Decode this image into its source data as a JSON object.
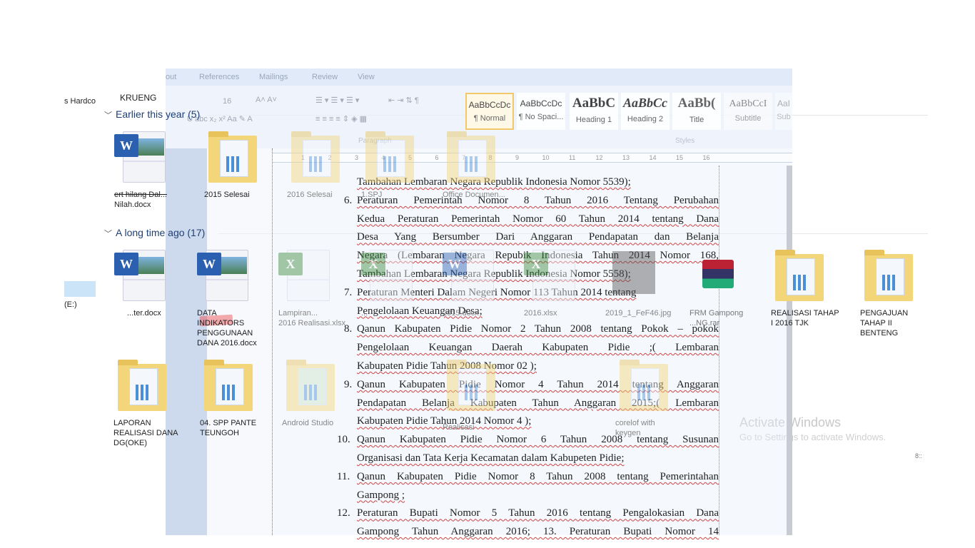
{
  "explorer": {
    "nav": {
      "drive_hardcopy": "s Hardco",
      "drive_e": "(E:)",
      "folder_header": "KRUENG"
    },
    "groups": [
      {
        "label": "Earlier this year (5)",
        "items": [
          {
            "name": "ert hilang Dal...",
            "name2": "Nilah.docx",
            "type": "word"
          },
          {
            "name": "2015 Selesai",
            "type": "folder"
          },
          {
            "name": "2016 Selesai",
            "type": "folder"
          },
          {
            "name": "1.SPJ",
            "type": "folder"
          },
          {
            "name": "Office Documen...",
            "type": "folder"
          }
        ]
      },
      {
        "label": "A long time ago (17)",
        "items": [
          {
            "name": "...ter.docx",
            "type": "word"
          },
          {
            "name": "DATA INDIKATORS PENGGUNAAN DANA 2016.docx",
            "type": "word"
          },
          {
            "name": "Lampiran...",
            "name2": "2016 Realisasi.xlsx",
            "type": "excel"
          },
          {
            "name": "...",
            "type": "excel"
          },
          {
            "name": "2015.docx",
            "type": "word"
          },
          {
            "name": "2016.xlsx",
            "type": "excel"
          },
          {
            "name": "2019_1_FeF46.jpg",
            "type": "image"
          },
          {
            "name": "FRM Gampong",
            "name2": "...NG.rar",
            "type": "rar"
          },
          {
            "name": "REALISASI TAHAP I 2016 TJK",
            "type": "folder"
          },
          {
            "name": "PENGAJUAN TAHAP II BENTENG",
            "type": "folder"
          },
          {
            "name": "LAPORAN REALISASI  DANA DG(OKE)",
            "type": "folder"
          },
          {
            "name": "04. SPP PANTE TEUNGOH",
            "type": "folder"
          },
          {
            "name": "Android Studio",
            "type": "folder"
          },
          {
            "name": "Realisasi",
            "type": "folder"
          },
          {
            "name": "corelof with keygen",
            "type": "folder"
          }
        ]
      }
    ],
    "status": "8::"
  },
  "word": {
    "tabs": [
      "out",
      "References",
      "Mailings",
      "Review",
      "View"
    ],
    "font_size": "16",
    "groups": {
      "paragraph": "Paragraph",
      "styles": "Styles"
    },
    "styles": [
      {
        "preview": "AaBbCcDc",
        "name": "¶ Normal",
        "selected": true
      },
      {
        "preview": "AaBbCcDc",
        "name": "¶ No Spaci..."
      },
      {
        "preview": "AaBbC",
        "name": "Heading 1"
      },
      {
        "preview": "AaBbCc",
        "name": "Heading 2"
      },
      {
        "preview": "AaBb(",
        "name": "Title"
      },
      {
        "preview": "AaBbCcI",
        "name": "Subtitle"
      },
      {
        "preview": "AaI",
        "name": "Sub"
      }
    ],
    "ruler": [
      "1",
      "2",
      "3",
      "4",
      "5",
      "6",
      "7",
      "8",
      "9",
      "10",
      "11",
      "12",
      "13",
      "14",
      "15",
      "16"
    ],
    "document": {
      "lines": [
        {
          "num": "",
          "text": "Tambahan Lembaran Negara Republik Indonesia Nomor 5539);",
          "j": false
        },
        {
          "num": "6.",
          "text": "Peraturan Pemerintah Nomor 8 Tahun 2016 Tentang Perubahan",
          "j": true
        },
        {
          "num": "",
          "text": "Kedua Peraturan Pemerintah Nomor 60 Tahun 2014 tentang Dana",
          "j": true
        },
        {
          "num": "",
          "text": "Desa  Yang Bersumber Dari Anggaran Pendapatan dan Belanja",
          "j": true
        },
        {
          "num": "",
          "text": "Negara (Lembaran Negara Repubik Indonesia Tahun 2014 Nomor 168,",
          "j": true
        },
        {
          "num": "",
          "text": "Tambahan Lembaran Negara Republik Indonesia Nomor 5558);",
          "j": false
        },
        {
          "num": "7.",
          "text": "Peraturan Menteri Dalam Negeri Nomor 113 Tahun 2014 tentang",
          "j": false
        },
        {
          "num": "",
          "text": "Pengelolaan Keuangan Desa;",
          "j": false
        },
        {
          "num": "8.",
          "text": "Qanun Kabupaten Pidie Nomor 2 Tahun 2008 tentang Pokok – pokok",
          "j": true
        },
        {
          "num": "",
          "text": "Pengelolaan Keuangan Daerah Kabupaten Pidie ;( Lembaran",
          "j": true
        },
        {
          "num": "",
          "text": "Kabupaten Pidie Tahun 2008  Nomor 02 );",
          "j": false
        },
        {
          "num": "9.",
          "text": "Qanun Kabupaten Pidie Nomor 4 Tahun  2014 tentang  Anggaran",
          "j": true
        },
        {
          "num": "",
          "text": "Pendapatan Belanja  Kabupaten Tahun Anggaran 2015;( Lembaran",
          "j": true
        },
        {
          "num": "",
          "text": "Kabupaten Pidie Tahun 2014 Nomor 4 );",
          "j": false
        },
        {
          "num": "10.",
          "text": "Qanun Kabupaten Pidie Nomor 6 Tahun 2008 tentang Susunan",
          "j": true
        },
        {
          "num": "",
          "text": "Organisasi dan Tata Kerja Kecamatan dalam Kabupeten Pidie;",
          "j": false
        },
        {
          "num": "11.",
          "text": "Qanun Kabupaten Pidie Nomor 8 Tahun 2008 tentang Pemerintahan",
          "j": true
        },
        {
          "num": "",
          "text": "Gampong ;",
          "j": false
        },
        {
          "num": "12.",
          "text": "Peraturan Bupati Nomor 5 Tahun 2016 tentang Pengalokasian Dana",
          "j": true
        },
        {
          "num": "",
          "text": "Gampong Tahun Anggaran 2016; 13. Peraturan Bupati Nomor 14",
          "j": true
        }
      ]
    }
  },
  "watermark": {
    "title": "Activate Windows",
    "subtitle": "Go to Settings to activate Windows."
  },
  "colors": {
    "accent": "#2b5fb0",
    "folder": "#f3d57a",
    "spellcheck": "#cc4444",
    "group_heading": "#1e3f73"
  }
}
